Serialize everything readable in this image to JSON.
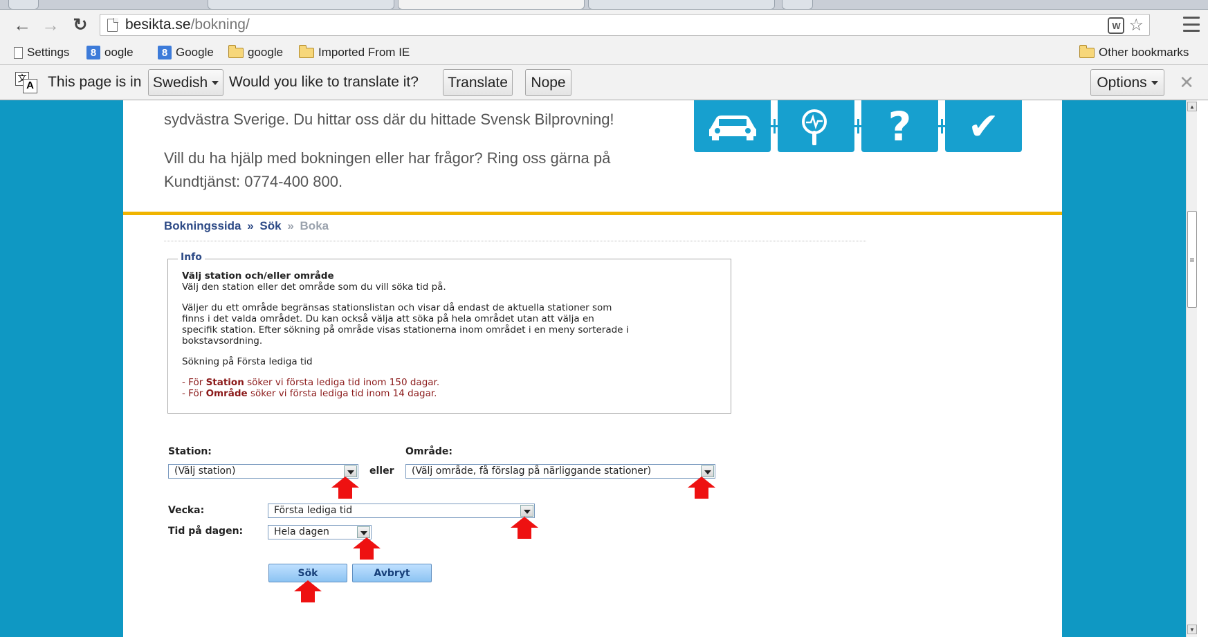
{
  "browser": {
    "url_host": "besikta.se",
    "url_path": "/bokning/",
    "bookmarks": [
      {
        "label": "Settings",
        "icon": "page-icon"
      },
      {
        "label": "oogle",
        "icon": "google-g-icon"
      },
      {
        "label": "Google",
        "icon": "google-g-icon"
      },
      {
        "label": "google",
        "icon": "folder-icon"
      },
      {
        "label": "Imported From IE",
        "icon": "folder-icon"
      }
    ],
    "other_bookmarks": "Other bookmarks",
    "translate_bar": {
      "prefix": "This page is in",
      "language": "Swedish",
      "question": "Would you like to translate it?",
      "translate_label": "Translate",
      "nope_label": "Nope",
      "options_label": "Options"
    }
  },
  "page": {
    "intro_line_1": "sydvästra Sverige. Du hittar oss där du hittade Svensk Bilprovning!",
    "intro_line_2": "Vill du ha hjälp med bokningen eller har frågor? Ring oss gärna på",
    "intro_line_3": "Kundtjänst: 0774-400 800.",
    "breadcrumb": {
      "item_1": "Bokningssida",
      "sep_1": "»",
      "item_2": "Sök",
      "sep_2": "»",
      "item_3": "Boka"
    },
    "info": {
      "legend": "Info",
      "heading": "Välj station och/eller område",
      "line_1": "Välj den station eller det område som du vill söka tid på.",
      "paragraph_2": "Väljer du ett område begränsas stationslistan och visar då endast de aktuella stationer som\nfinns i det valda området. Du kan också välja att söka på hela området utan att välja en\nspecifik station. Efter sökning på område visas stationerna inom området i en meny sorterade i\nbokstavsordning.",
      "paragraph_3": "Sökning på Första lediga tid",
      "rule_1_prefix": "- För",
      "rule_1_bold": "Station",
      "rule_1_suffix": "söker vi första lediga tid inom 150 dagar.",
      "rule_2_prefix": "- För",
      "rule_2_bold": "Område",
      "rule_2_suffix": "söker vi första lediga tid inom 14 dagar."
    },
    "form": {
      "station_label": "Station:",
      "station_value": "(Välj station)",
      "or_label": "eller",
      "area_label": "Område:",
      "area_value": "(Välj område, få förslag på närliggande stationer)",
      "week_label": "Vecka:",
      "week_value": "Första lediga tid",
      "time_label": "Tid på dagen:",
      "time_value": "Hela dagen",
      "search_label": "Sök",
      "cancel_label": "Avbryt"
    }
  },
  "colors": {
    "page_background": "#0f98c3",
    "accent_line": "#f0b400",
    "link_blue": "#2d4a86",
    "annotation_arrow": "#ee1111"
  }
}
